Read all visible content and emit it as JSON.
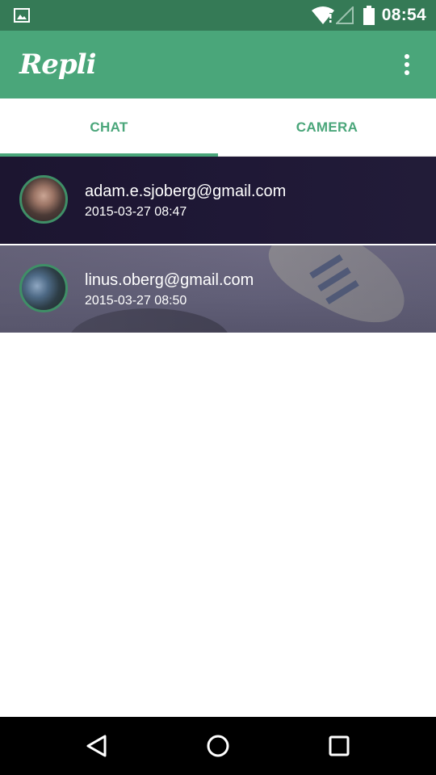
{
  "status_bar": {
    "time": "08:54",
    "icons": [
      "gallery-icon",
      "wifi-icon",
      "signal-icon",
      "battery-icon"
    ]
  },
  "app_bar": {
    "title": "Repli",
    "overflow_icon": "more-vert-icon"
  },
  "tabs": [
    {
      "label": "CHAT",
      "active": true
    },
    {
      "label": "CAMERA",
      "active": false
    }
  ],
  "chats": [
    {
      "email": "adam.e.sjoberg@gmail.com",
      "time": "2015-03-27 08:47"
    },
    {
      "email": "linus.oberg@gmail.com",
      "time": "2015-03-27 08:50"
    }
  ],
  "nav_bar": {
    "icons": [
      "back-icon",
      "home-icon",
      "recents-icon"
    ]
  },
  "colors": {
    "status_bar": "#357a56",
    "app_bar": "#4aa67a",
    "accent": "#4aa67a",
    "nav_bar": "#000000"
  }
}
